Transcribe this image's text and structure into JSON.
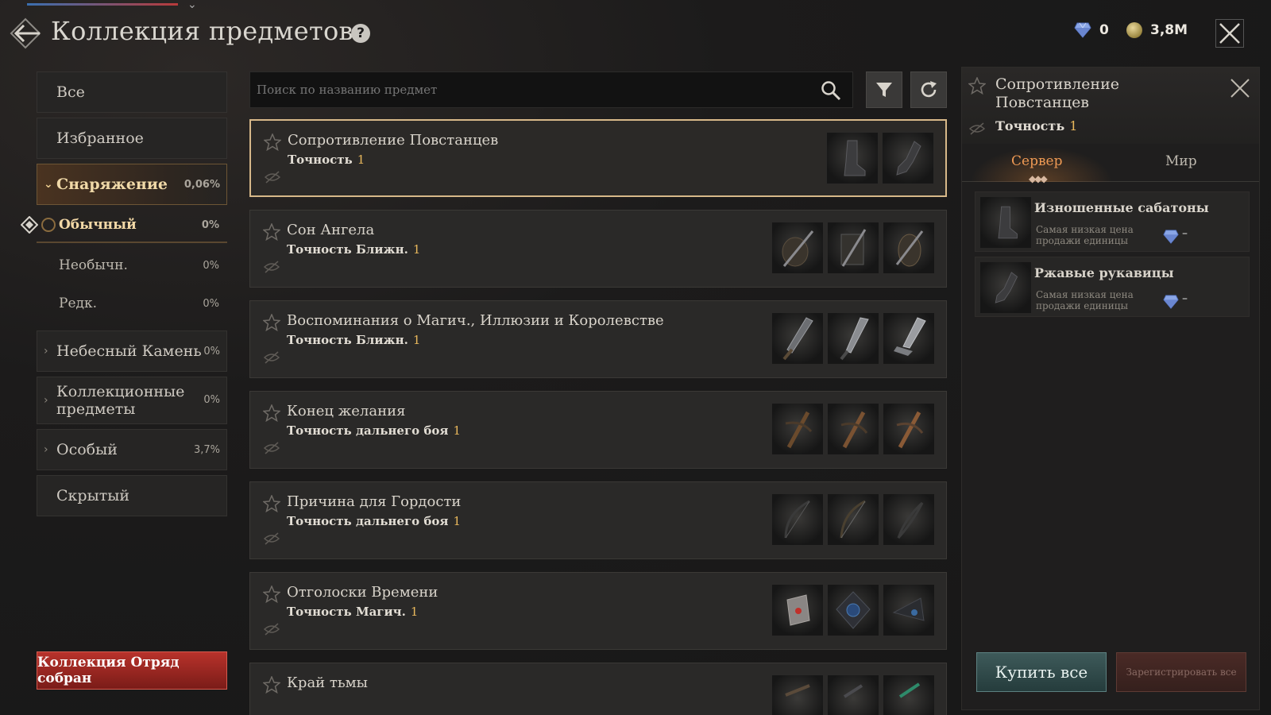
{
  "header": {
    "title": "Коллекция предметов",
    "help": "?",
    "gems": "0",
    "gold": "3,8M"
  },
  "sidebar": {
    "items": [
      {
        "label": "Все"
      },
      {
        "label": "Избранное"
      },
      {
        "label": "Снаряжение",
        "pct": "0,06%"
      },
      {
        "label": "Небесный Камень",
        "pct": "0%"
      },
      {
        "label": "Коллекционные предметы",
        "pct": "0%"
      },
      {
        "label": "Особый",
        "pct": "3,7%"
      },
      {
        "label": "Скрытый"
      }
    ],
    "subitems": [
      {
        "label": "Обычный",
        "pct": "0%"
      },
      {
        "label": "Необычн.",
        "pct": "0%"
      },
      {
        "label": "Редк.",
        "pct": "0%"
      }
    ],
    "collect_button": "Коллекция Отряд собран"
  },
  "search": {
    "placeholder": "Поиск по названию предмет"
  },
  "list": [
    {
      "name": "Сопротивление Повстанцев",
      "stat": "Точность",
      "val": "1"
    },
    {
      "name": "Сон Ангела",
      "stat": "Точность Ближн.",
      "val": "1"
    },
    {
      "name": "Воспоминания о Магич., Иллюзии и Королевстве",
      "stat": "Точность Ближн.",
      "val": "1"
    },
    {
      "name": "Конец желания",
      "stat": "Точность дальнего боя",
      "val": "1"
    },
    {
      "name": "Причина для Гордости",
      "stat": "Точность дальнего боя",
      "val": "1"
    },
    {
      "name": "Отголоски Времени",
      "stat": "Точность Магич.",
      "val": "1"
    },
    {
      "name": "Край тьмы"
    }
  ],
  "detail": {
    "title": "Сопротивление Повстанцев",
    "stat": "Точность",
    "val": "1",
    "tabs": [
      "Сервер",
      "Мир"
    ],
    "materials": [
      {
        "name": "Изношенные сабатоны",
        "label": "Самая низкая цена продажи единицы",
        "price": "–"
      },
      {
        "name": "Ржавые рукавицы",
        "label": "Самая низкая цена продажи единицы",
        "price": "–"
      }
    ],
    "buy_all": "Купить все",
    "register_all": "Зарегистрировать все"
  },
  "colors": {
    "accent_gold": "#e9b85c",
    "selected_border": "#d7b889",
    "collect_red": "#b8322b",
    "buy_teal": "#3e5a5a"
  }
}
